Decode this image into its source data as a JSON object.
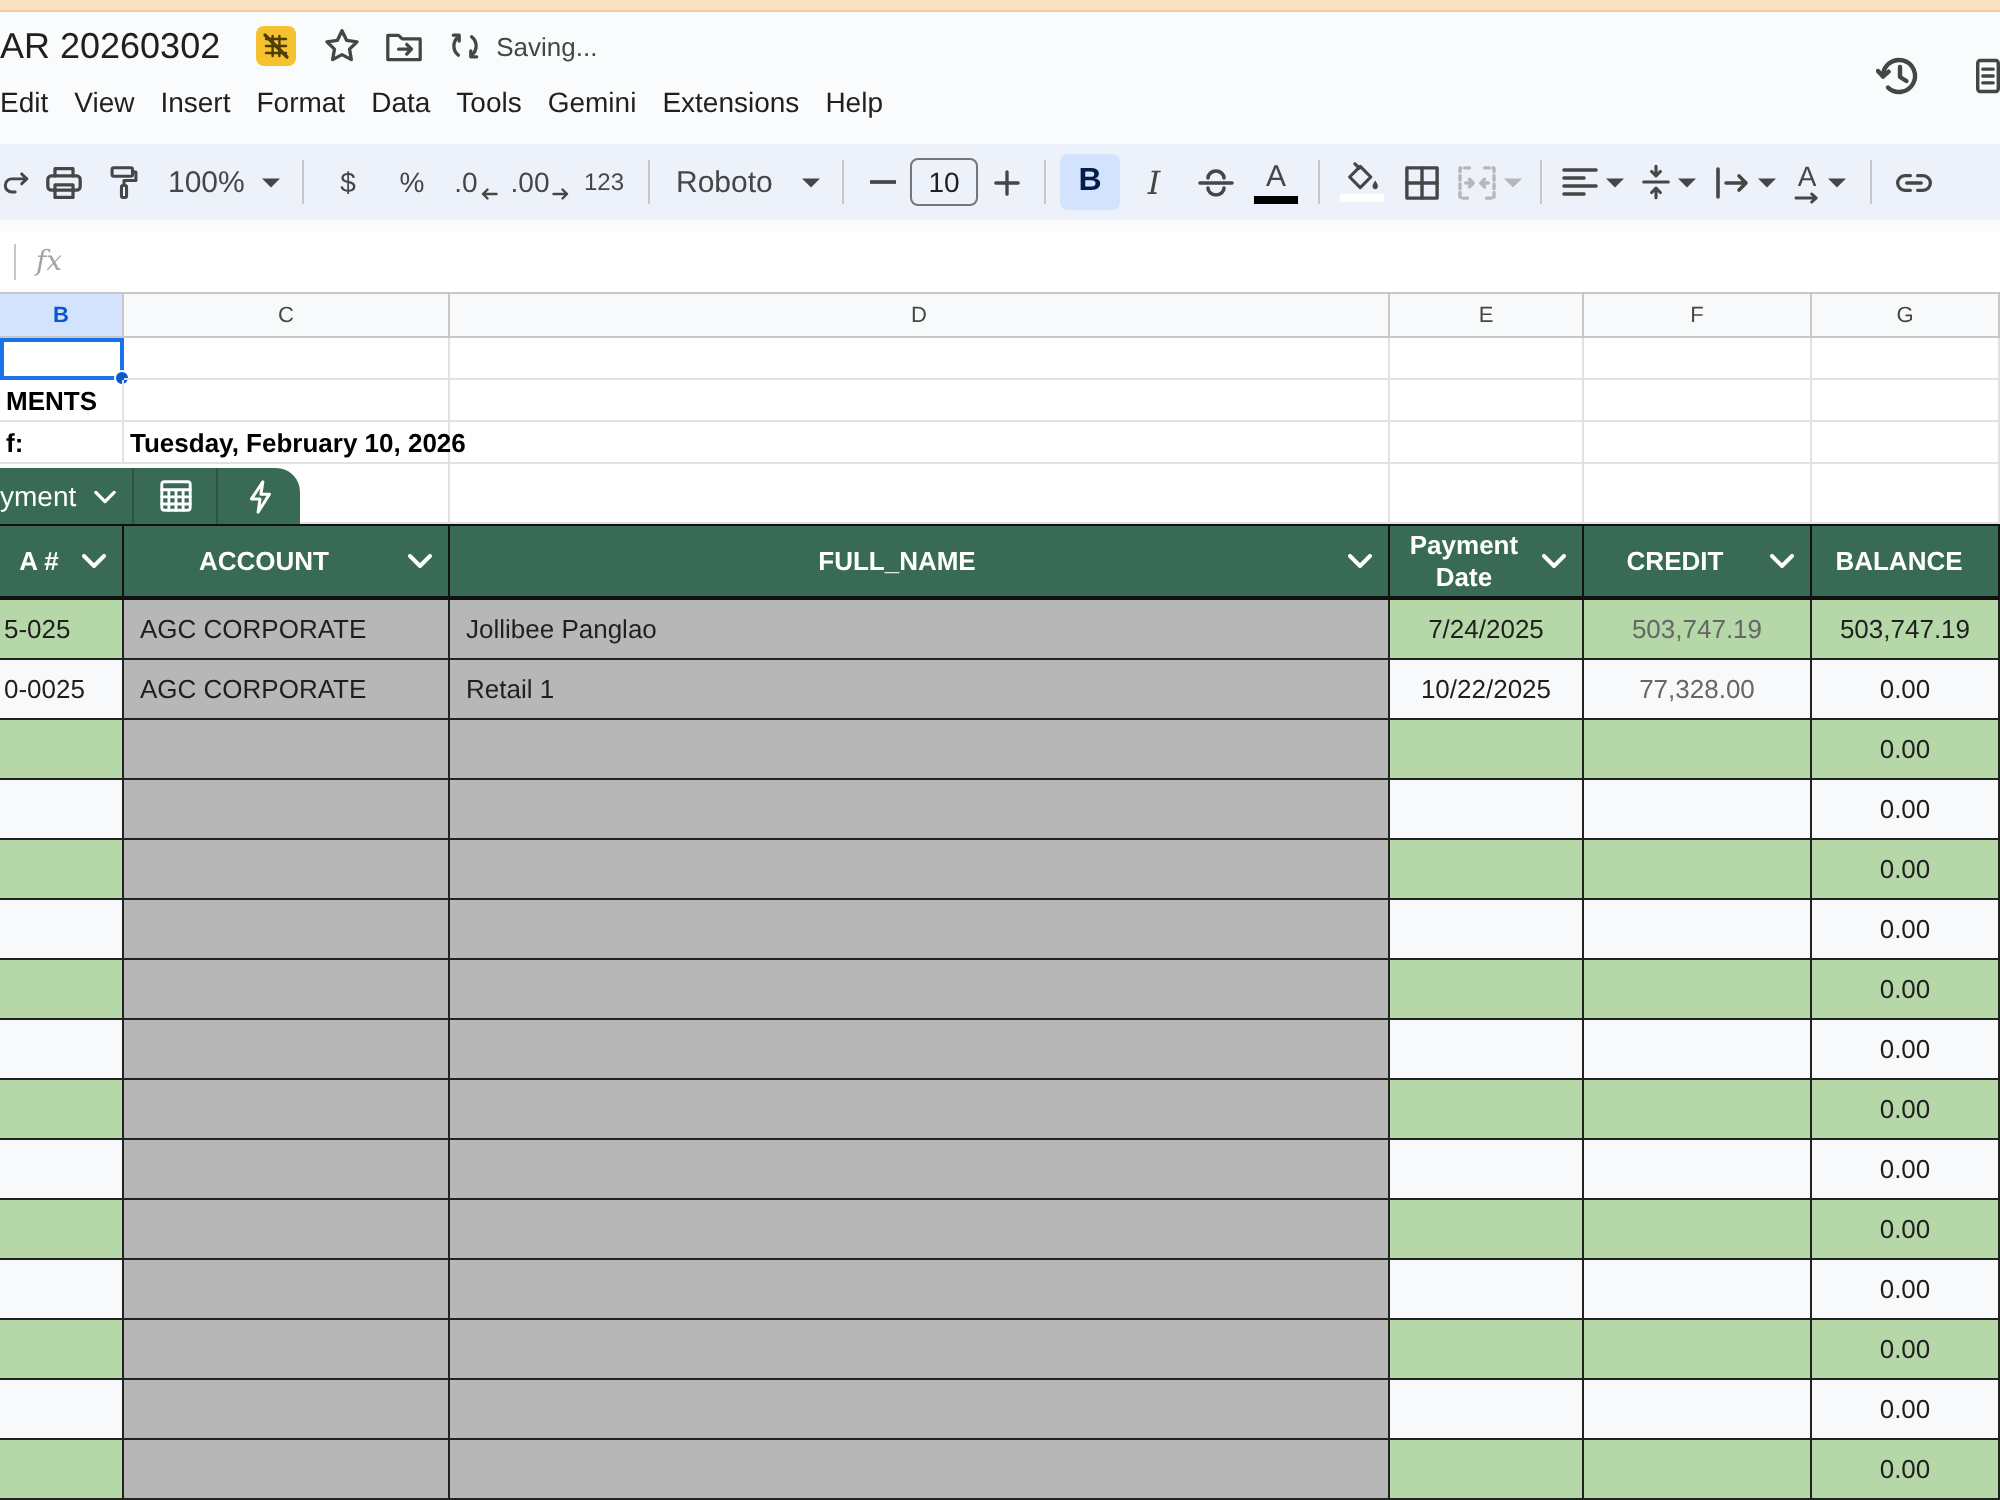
{
  "document": {
    "title": "AR 20260302",
    "save_status": "Saving..."
  },
  "menu": [
    "Edit",
    "View",
    "Insert",
    "Format",
    "Data",
    "Tools",
    "Gemini",
    "Extensions",
    "Help"
  ],
  "toolbar": {
    "zoom": "100%",
    "number_formats": [
      {
        "kind": "currency",
        "label": "$"
      },
      {
        "kind": "percent",
        "label": "%"
      },
      {
        "kind": "decrease_decimal",
        "label": ".0"
      },
      {
        "kind": "increase_decimal",
        "label": ".00"
      },
      {
        "kind": "format",
        "label": "123"
      }
    ],
    "font": "Roboto",
    "font_size": "10",
    "text_styles": [
      {
        "kind": "bold",
        "label": "B",
        "selected": true
      },
      {
        "kind": "italic",
        "label": "I",
        "selected": false
      }
    ],
    "text_color_label": "A",
    "merge": {
      "disabled": true
    },
    "rotation_label": "A"
  },
  "formula_bar": {
    "label": "fx"
  },
  "sheet": {
    "columns": [
      {
        "label": "B",
        "selected": true
      },
      {
        "label": "C",
        "selected": false
      },
      {
        "label": "D",
        "selected": false
      },
      {
        "label": "E",
        "selected": false
      },
      {
        "label": "F",
        "selected": false
      },
      {
        "label": "G",
        "selected": false
      }
    ],
    "top_rows": [
      {
        "selected": true
      },
      {
        "selected": false,
        "cells": [
          "MENTS"
        ]
      },
      {
        "selected": false,
        "cells": [
          "f:",
          "Tuesday, February 10, 2026"
        ]
      }
    ]
  },
  "table": {
    "name": "yment",
    "columns": [
      {
        "label": "A #",
        "dropdown": true
      },
      {
        "label": "ACCOUNT",
        "dropdown": true
      },
      {
        "label": "FULL_NAME",
        "dropdown": true
      },
      {
        "label": "Payment Date",
        "dropdown": true
      },
      {
        "label": "CREDIT",
        "dropdown": true
      },
      {
        "label": "BALANCE",
        "dropdown": false
      }
    ],
    "rows": [
      {
        "b": "5-025",
        "c": "AGC CORPORATE",
        "d": "Jollibee Panglao",
        "e": "7/24/2025",
        "f": "503,747.19",
        "g": "503,747.19"
      },
      {
        "b": "0-0025",
        "c": "AGC CORPORATE",
        "d": "Retail 1",
        "e": "10/22/2025",
        "f": "77,328.00",
        "g": "0.00"
      },
      {
        "g": "0.00"
      },
      {
        "g": "0.00"
      },
      {
        "g": "0.00"
      },
      {
        "g": "0.00"
      },
      {
        "g": "0.00"
      },
      {
        "g": "0.00"
      },
      {
        "g": "0.00"
      },
      {
        "g": "0.00"
      },
      {
        "g": "0.00"
      },
      {
        "g": "0.00"
      },
      {
        "g": "0.00"
      },
      {
        "g": "0.00"
      },
      {
        "g": "0.00"
      }
    ]
  }
}
